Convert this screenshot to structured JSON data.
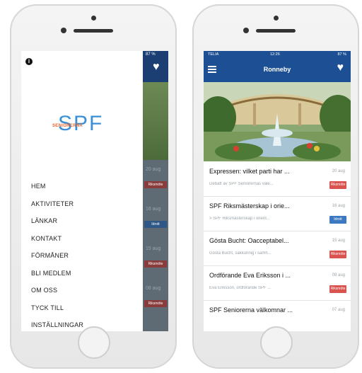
{
  "left_phone": {
    "logo": {
      "text": "SPF",
      "subtitle": "SENIORERNA"
    },
    "menu": [
      "HEM",
      "AKTIVITETER",
      "LÄNKAR",
      "KONTAKT",
      "FÖRMÅNER",
      "BLI MEDLEM",
      "OM OSS",
      "TYCK TILL",
      "INSTÄLLNINGAR"
    ],
    "behind": {
      "status": "87 %",
      "dates": [
        "20 aug",
        "16 aug",
        "15 aug",
        "08 aug"
      ],
      "tags": [
        {
          "label": "Riksmöte",
          "color": "#d9534f"
        },
        {
          "label": "Idrott",
          "color": "#3c79c0"
        },
        {
          "label": "Riksmöte",
          "color": "#d9534f"
        },
        {
          "label": "Riksmöte",
          "color": "#d9534f"
        }
      ]
    }
  },
  "right_phone": {
    "status_bar": {
      "carrier": "TELIA",
      "time": "12:26",
      "battery": "87 %"
    },
    "title": "Ronneby",
    "news": [
      {
        "title": "Expressen: vilket parti har ...",
        "date": "20 aug",
        "snippet": "Debatt av SPF Seniorernas vale...",
        "tag": "Riksmöte",
        "tag_color": "#d9534f"
      },
      {
        "title": "SPF Riksmästerskap i orie...",
        "date": "16 aug",
        "snippet": "> SPF Riksmästerskap i orient...",
        "tag": "Idrott",
        "tag_color": "#3c79c0"
      },
      {
        "title": "Gösta Bucht: Oacceptabel...",
        "date": "15 aug",
        "snippet": "Gösta Bucht, sakkunnig i samh...",
        "tag": "Riksmöte",
        "tag_color": "#d9534f"
      },
      {
        "title": "Ordförande Eva Eriksson i ...",
        "date": "08 aug",
        "snippet": "Eva Eriksson, ordförande SPF ...",
        "tag": "Riksmöte",
        "tag_color": "#d9534f"
      },
      {
        "title": "SPF Seniorerna välkomnar ...",
        "date": "07 aug",
        "snippet": "",
        "tag": "",
        "tag_color": "#d9534f"
      }
    ]
  },
  "colors": {
    "header_blue": "#1c4f93",
    "accent_orange": "#e8642c",
    "logo_blue": "#3a8fd6"
  },
  "icons": [
    "info-icon",
    "heart-icon",
    "hamburger-menu-icon"
  ]
}
